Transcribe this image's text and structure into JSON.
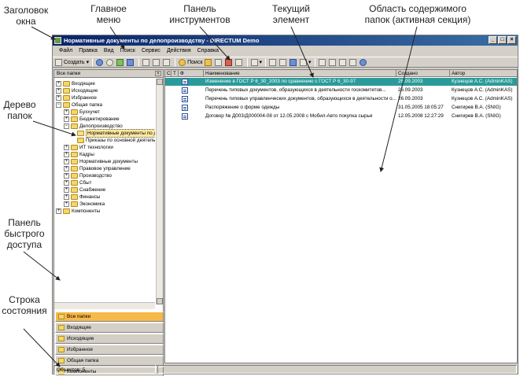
{
  "callouts": {
    "title_bar": "Заголовок окна",
    "main_menu": "Главное меню",
    "toolbar": "Панель инструментов",
    "current_element": "Текущий элемент",
    "content_area": "Область содержимого папок (активная секция)",
    "folder_tree": "Дерево папок",
    "quick_access": "Панель быстрого доступа",
    "status_bar": "Строка состояния"
  },
  "window": {
    "title": "Нормативные документы по делопроизводству - DIRECTUM Demo",
    "buttons": [
      "_",
      "□",
      "×"
    ]
  },
  "menu": [
    "Файл",
    "Правка",
    "Вид",
    "Поиск",
    "Сервис",
    "Действия",
    "Справка"
  ],
  "toolbar": {
    "create_label": "Создать",
    "search_label": "Поиск"
  },
  "left_pane": {
    "header": "Все папки",
    "tree": [
      {
        "label": "Входящие",
        "level": 0,
        "expander": "+"
      },
      {
        "label": "Исходящие",
        "level": 0,
        "expander": "+"
      },
      {
        "label": "Избранное",
        "level": 0,
        "expander": "+"
      },
      {
        "label": "Общая папка",
        "level": 0,
        "expander": "−"
      },
      {
        "label": "Буххучет",
        "level": 1,
        "expander": "+"
      },
      {
        "label": "Бюджетирование",
        "level": 1,
        "expander": "+"
      },
      {
        "label": "Делопроизводство",
        "level": 1,
        "expander": "−"
      },
      {
        "label": "Нормативные документы по дело",
        "level": 2,
        "expander": "",
        "active": true
      },
      {
        "label": "Приказы по основной деятельно",
        "level": 2,
        "expander": ""
      },
      {
        "label": "ИТ технологии",
        "level": 1,
        "expander": "+"
      },
      {
        "label": "Кадры",
        "level": 1,
        "expander": "+"
      },
      {
        "label": "Нормативные документы",
        "level": 1,
        "expander": "+"
      },
      {
        "label": "Правовое управление",
        "level": 1,
        "expander": "+"
      },
      {
        "label": "Производство",
        "level": 1,
        "expander": "+"
      },
      {
        "label": "Сбыт",
        "level": 1,
        "expander": "+"
      },
      {
        "label": "Снабжение",
        "level": 1,
        "expander": "+"
      },
      {
        "label": "Финансы",
        "level": 1,
        "expander": "+"
      },
      {
        "label": "Экономика",
        "level": 1,
        "expander": "+"
      },
      {
        "label": "Компоненты",
        "level": 0,
        "expander": "+"
      }
    ]
  },
  "quick_access": [
    {
      "label": "Все папки",
      "active": true
    },
    {
      "label": "Входящие"
    },
    {
      "label": "Исходящие"
    },
    {
      "label": "Избранное"
    },
    {
      "label": "Общая папка"
    },
    {
      "label": "Компоненты"
    },
    {
      "label": "Ярлыки"
    }
  ],
  "grid": {
    "columns": [
      "С",
      "Т",
      "Ф",
      "Наименование",
      "Создано",
      "Автор"
    ],
    "rows": [
      {
        "name": "Изменение в ГОСТ Р 6_30_2003 по сравнению с ГОСТ Р 6_30-97",
        "created": "26.09.2003",
        "author": "Кузнецов А.С. (AdminKAS)",
        "selected": true
      },
      {
        "name": "Перечень типовых документов, образующихся в деятельности госкомитетов...",
        "created": "26.09.2003",
        "author": "Кузнецов А.С. (AdminKAS)"
      },
      {
        "name": "Перечень типовых управленческих документов, образующихся в деятельности о...",
        "created": "26.09.2003",
        "author": "Кузнецов А.С. (AdminKAS)"
      },
      {
        "name": "Распоряжение о форме одежды",
        "created": "31.05.2005 18:05:27",
        "author": "Снигирев В.А. (SNIG)"
      },
      {
        "name": "Договор № Д003/Д000004-08 от 12.05.2008 с Мобил-Авто покупка сырья",
        "created": "12.05.2008 12:27:29",
        "author": "Снигирев В.А. (SNIG)"
      }
    ]
  },
  "status": {
    "objects": "Объектов: 5"
  }
}
